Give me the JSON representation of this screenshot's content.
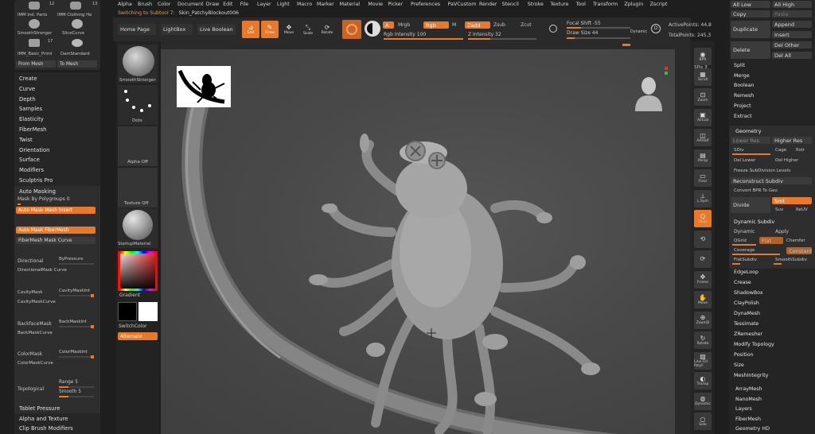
{
  "top_menu": [
    "Alpha",
    "Brush",
    "Color",
    "Document",
    "Draw",
    "Edit",
    "File",
    "Layer",
    "Light",
    "Macro",
    "Marker",
    "Material",
    "Movie",
    "Picker",
    "Preferences",
    "PaVCustom",
    "Render",
    "Stencil",
    "Stroke",
    "Texture",
    "Tool",
    "Transform",
    "Zplugin",
    "Zscript"
  ],
  "status": {
    "switching": "Switching to Subtool 7:",
    "subtool_name": "Skin_PatchyBlockout006"
  },
  "brushes": {
    "b1": "IMM Ind. Parts",
    "b1_count": "12",
    "b2": "IMM Clothing He",
    "b2_count": "13",
    "b3": "SmoothStronger",
    "b4": "SliceCurve",
    "b5": "IMM_Basic_Primi",
    "b5_count": "17",
    "b6": "DamStandard",
    "from_mesh": "From Mesh",
    "to_mesh": "To Mesh"
  },
  "left_menu": [
    "Create",
    "Curve",
    "Depth",
    "Samples",
    "Elasticity",
    "FiberMesh",
    "Twist",
    "Orientation",
    "Surface",
    "Modifiers",
    "Sculptris Pro"
  ],
  "masking": {
    "title": "Auto Masking",
    "mask_by_polygroups": "Mask By Polygroups 0",
    "auto_mask_mesh_insert": "Auto Mask Mesh Insert",
    "auto_mask_fibermesh": "Auto Mask FiberMesh",
    "fibermesh_mask_curve": "FiberMesh Mask Curve",
    "directional": "Directional",
    "by_pressure": "ByPressure",
    "directional_mask_curve": "DirectionalMask Curve",
    "cavity_mask": "CavityMask",
    "cavity_mask_int": "CavityMaskInt",
    "cavity_mask_curve": "CavityMaskCurve",
    "backface_mask": "BackfaceMask",
    "back_mask_int": "BackMaskInt",
    "back_mask_curve": "BackMaskCurve",
    "color_mask": "ColorMask",
    "color_mask_int": "ColorMaskInt",
    "color_mask_curve": "ColorMaskCurve",
    "topological": "Topological",
    "range": "Range 5",
    "smooth": "Smooth 5"
  },
  "left_bottom": [
    "Tablet Pressure",
    "Alpha and Texture",
    "Clip Brush Modifiers"
  ],
  "shelf": {
    "brush": "SmoothStronger",
    "stroke": "Dots",
    "alpha": "Alpha Off",
    "texture": "Texture Off",
    "material": "StartupMaterial",
    "gradient": "Gradient",
    "switch_color": "SwitchColor",
    "alternate": "Alternate"
  },
  "toolbar": {
    "home": "Home Page",
    "lightbox": "LightBox",
    "live_boolean": "Live Boolean",
    "edit": "Edit",
    "draw": "Draw",
    "move": "Move",
    "scale": "Scale",
    "rotate": "Rotate",
    "a": "A",
    "mrgb": "Mrgb",
    "rgb": "Rgb",
    "m": "M",
    "zadd": "Zadd",
    "zsub": "Zsub",
    "zcut": "Zcut",
    "rgb_intensity": "Rgb Intensity 100",
    "z_intensity": "Z Intensity 32",
    "focal_shift": "Focal Shift -55",
    "draw_size": "Draw Size 44",
    "dynamic": "Dynamic",
    "active_points": "ActivePoints: 44,8",
    "total_points": "TotalPoints: 245,3"
  },
  "right_tools": [
    {
      "glyph": "◉",
      "label": "BPR"
    },
    {
      "glyph": "▦",
      "label": "Scroll"
    },
    {
      "glyph": "⊡",
      "label": "Zoom"
    },
    {
      "glyph": "▣",
      "label": "Actual"
    },
    {
      "glyph": "◫",
      "label": "AAHalf"
    },
    {
      "glyph": "▤",
      "label": "Persp"
    },
    {
      "glyph": "▭",
      "label": "Floor"
    },
    {
      "glyph": "⟂",
      "label": "L.Sym"
    },
    {
      "glyph": "Q",
      "label": "Qxyz"
    },
    {
      "glyph": "⟲",
      "label": ""
    },
    {
      "glyph": "⟳",
      "label": ""
    },
    {
      "glyph": "✥",
      "label": "Frame"
    },
    {
      "glyph": "✋",
      "label": "Move"
    },
    {
      "glyph": "⊕",
      "label": "ZoomD"
    },
    {
      "glyph": "↻",
      "label": "Rotate"
    },
    {
      "glyph": "▨",
      "label": "Line Fill PolyF"
    },
    {
      "glyph": "◐",
      "label": "Transp"
    },
    {
      "glyph": "◍",
      "label": "Dynamic"
    },
    {
      "glyph": "○",
      "label": "Solo"
    }
  ],
  "spix": "SPix 3",
  "right_panel": {
    "all_low": "All Low",
    "all_high": "All High",
    "copy": "Copy",
    "paste": "Paste",
    "duplicate": "Duplicate",
    "append": "Append",
    "insert": "Insert",
    "delete": "Delete",
    "del_other": "Del Other",
    "del_all": "Del All",
    "items1": [
      "Split",
      "Merge",
      "Boolean",
      "Remesh",
      "Project",
      "Extract"
    ],
    "geometry": "Geometry",
    "lower_res": "Lower Res",
    "higher_res": "Higher Res",
    "sdiv": "SDiv",
    "cage": "Cage",
    "rstr": "Rstr",
    "del_lower": "Del Lower",
    "del_higher": "Del Higher",
    "freeze": "Freeze SubDivision Levels",
    "reconstruct": "Reconstruct Subdiv",
    "convert": "Convert BPR To Geo",
    "divide": "Divide",
    "smt": "Smt",
    "suv": "Suv",
    "reuv": "ReUV",
    "dynamic_subdiv": "Dynamic Subdiv",
    "dynamic": "Dynamic",
    "apply": "Apply",
    "qgrid": "QGrid",
    "flat": "Flat",
    "chamfer": "Chamfer",
    "coverage": "Coverage",
    "constant": "Constant",
    "flatsubdiv": "FlatSubdiv",
    "smoothsubdiv": "SmoothSubdiv",
    "items2": [
      "EdgeLoop",
      "Crease",
      "ShadowBox",
      "ClayPolish",
      "DynaMesh",
      "Tessimate",
      "ZRemesher",
      "Modify Topology",
      "Position",
      "Size",
      "MeshIntegrity"
    ],
    "items3": [
      "ArrayMesh",
      "NanoMesh",
      "Layers",
      "FiberMesh",
      "Geometry HD"
    ]
  },
  "colors": {
    "accent": "#e8792a",
    "canvas": "#4a4a4a",
    "panel": "#2b2b2b"
  }
}
